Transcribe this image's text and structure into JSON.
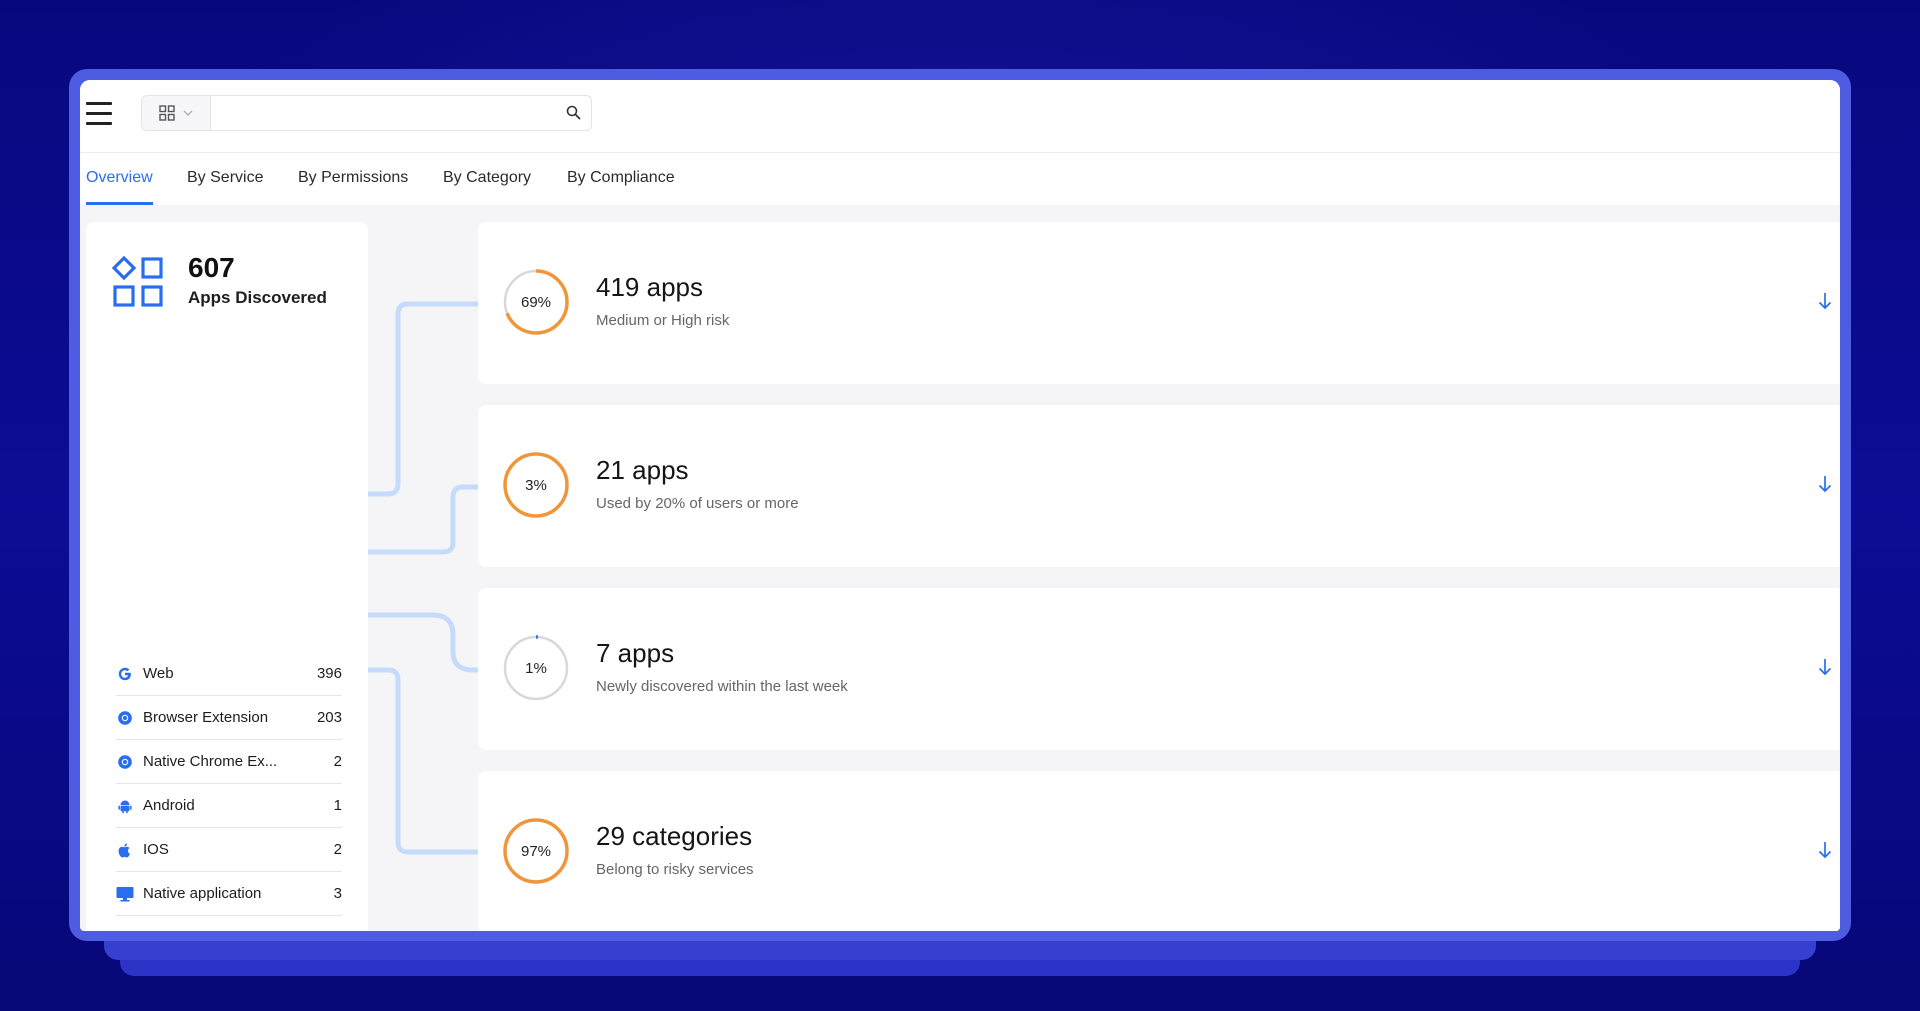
{
  "search": {
    "placeholder": ""
  },
  "tabs": [
    {
      "label": "Overview",
      "active": true
    },
    {
      "label": "By Service",
      "active": false
    },
    {
      "label": "By Permissions",
      "active": false
    },
    {
      "label": "By Category",
      "active": false
    },
    {
      "label": "By Compliance",
      "active": false
    }
  ],
  "summary": {
    "count": "607",
    "label": "Apps Discovered"
  },
  "sources": [
    {
      "name": "Web",
      "count": "396",
      "icon": "google-icon"
    },
    {
      "name": "Browser Extension",
      "count": "203",
      "icon": "chrome-icon"
    },
    {
      "name": "Native Chrome Ex...",
      "count": "2",
      "icon": "chrome-icon"
    },
    {
      "name": "Android",
      "count": "1",
      "icon": "android-icon"
    },
    {
      "name": "IOS",
      "count": "2",
      "icon": "apple-icon"
    },
    {
      "name": "Native application",
      "count": "3",
      "icon": "monitor-icon"
    }
  ],
  "stats": [
    {
      "percent_label": "69%",
      "percent": 69,
      "title": "419 apps",
      "subtitle": "Medium or High risk",
      "ring_color": "#f0963a"
    },
    {
      "percent_label": "3%",
      "percent": 100,
      "title": "21 apps",
      "subtitle": "Used by 20% of users or more",
      "ring_color": "#f0963a"
    },
    {
      "percent_label": "1%",
      "percent": 1,
      "title": "7 apps",
      "subtitle": "Newly discovered within the last week",
      "ring_color": "#2a6ef0"
    },
    {
      "percent_label": "97%",
      "percent": 100,
      "title": "29 categories",
      "subtitle": "Belong to risky services",
      "ring_color": "#f0963a"
    }
  ],
  "colors": {
    "accent": "#2a6ef0",
    "warning": "#f0963a",
    "background": "#0a0a8c",
    "frame": "#4d5ce0",
    "connector": "#c5dbfb"
  }
}
